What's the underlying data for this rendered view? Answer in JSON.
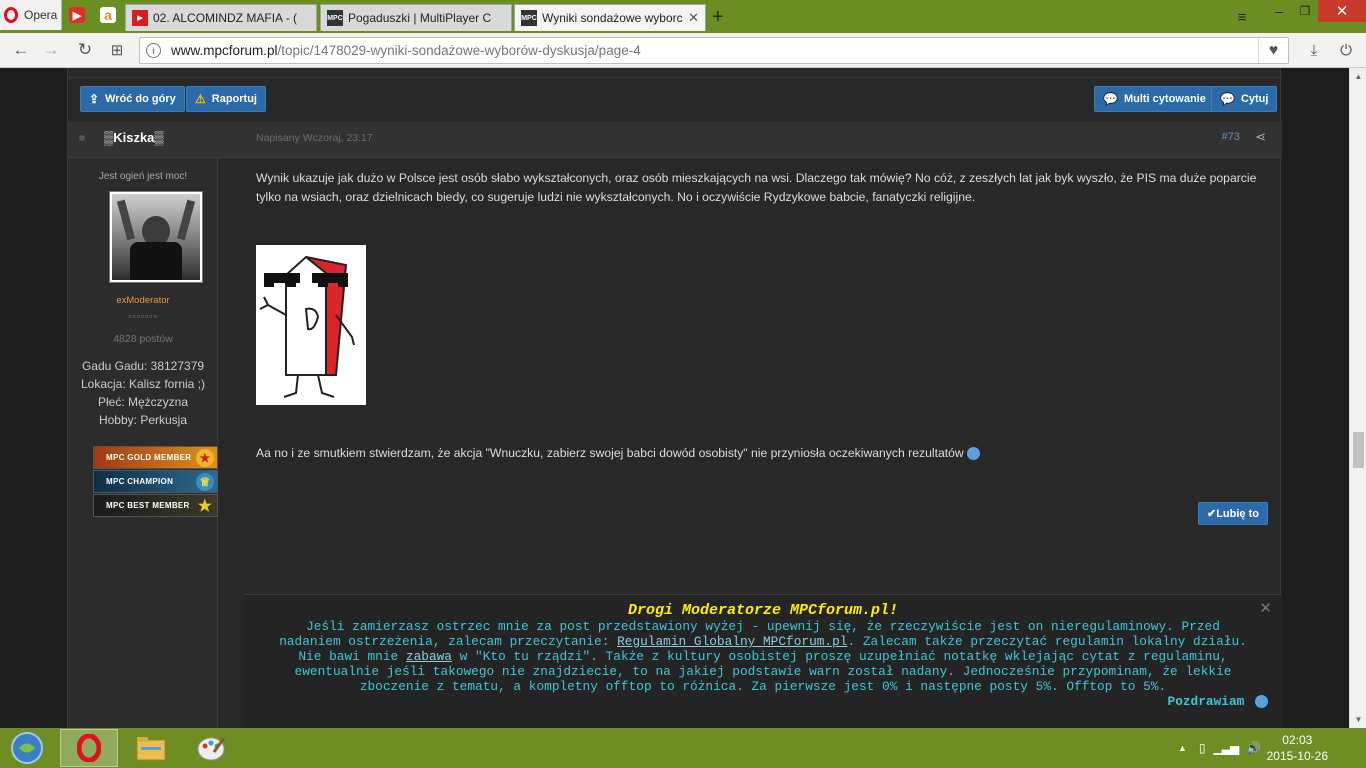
{
  "browser": {
    "menu_label": "Opera",
    "tabs": [
      {
        "title": "02. ALCOMINDZ MAFIA - (",
        "fav_color": "#d62020",
        "active": false
      },
      {
        "title": "Pogaduszki | MultiPlayer C",
        "fav_color": "#333333",
        "active": false
      },
      {
        "title": "Wyniki sondażowe wyborc",
        "fav_color": "#333333",
        "active": true
      }
    ],
    "url_domain": "www.mpcforum.pl",
    "url_path": "/topic/1478029-wyniki-sondażowe-wyborów-dyskusja/page-4"
  },
  "toolbar": {
    "back_to_top": "Wróć do góry",
    "report": "Raportuj",
    "multi_quote": "Multi cytowanie",
    "quote": "Cytuj"
  },
  "post": {
    "username": "▒Kiszka▒",
    "date": "Napisany Wczoraj, 23:17",
    "number": "#73",
    "user_title": "Jest ogień jest moc!",
    "rank": "exModerator",
    "pips": "▫▫▫▫▫▫▫",
    "post_count": "4828 postów",
    "fields": [
      "Gadu Gadu: 38127379",
      "Lokacja: Kalisz fornia ;)",
      "Płeć: Mężczyzna",
      "Hobby: Perkusja"
    ],
    "badges": [
      {
        "label": "MPC GOLD MEMBER",
        "bg": "#7a2a12",
        "medal": "#ffcc33"
      },
      {
        "label": "MPC CHAMPION",
        "bg": "#12334d",
        "medal": "#ffd84a"
      },
      {
        "label": "MPC BEST MEMBER",
        "bg": "#1f2a10",
        "medal": "#f2c824"
      }
    ],
    "paragraph1": "Wynik ukazuje jak dużo w Polsce jest osób słabo wykształconych, oraz osób mieszkających na wsi. Dlaczego tak mówię? No cóż, z zeszłych lat jak byk wyszło, że PIS ma duże poparcie tylko na wsiach, oraz dzielnicach biedy, co sugeruje ludzi nie wykształconych. No i oczywiście Rydzykowe babcie, fanatyczki religijne.",
    "paragraph2": "Aa no i ze smutkiem stwierdzam, że akcja \"Wnuczku, zabierz swojej babci dowód osobisty\" nie przyniosła oczekiwanych rezultatów",
    "like_label": "✔Lubię to"
  },
  "mod_note": {
    "title": "Drogi Moderatorze MPCforum.pl!",
    "line1": "Jeśli zamierzasz ostrzec mnie za post przedstawiony wyżej - upewnij się, że rzeczywiście jest on nieregulaminowy. Przed",
    "line2a": "nadaniem ostrzeżenia, zalecam przeczytanie:",
    "link1": "Regulamin Globalny MPCforum.pl",
    "line2b": ". Zalecam także przeczytać regulamin lokalny działu.",
    "line3a": "Nie bawi mnie",
    "link2": "zabawa",
    "line3b": "w \"Kto tu rządzi\". Także z kultury osobistej proszę uzupełniać notatkę wklejając cytat z regulaminu,",
    "line4": "ewentualnie jeśli takowego nie znajdziecie, to na jakiej podstawie warn został nadany. Jednocześnie przypominam, że lekkie",
    "line5": "zboczenie z tematu, a kompletny offtop to różnica. Za pierwsze jest 0% i następne posty 5%. Offtop to 5%.",
    "sign": "Pozdrawiam"
  },
  "taskbar": {
    "time": "02:03",
    "date": "2015-10-26"
  }
}
